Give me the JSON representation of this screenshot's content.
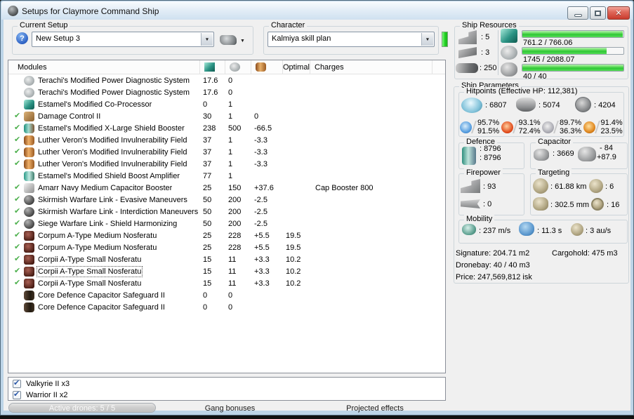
{
  "window": {
    "title": "Setups for Claymore Command Ship"
  },
  "setup": {
    "group_label": "Current Setup",
    "value": "New Setup 3"
  },
  "character": {
    "group_label": "Character",
    "value": "Kalmiya skill plan"
  },
  "resources": {
    "group_label": "Ship Resources",
    "turrets": ": 5",
    "launchers": ": 3",
    "calibration": ": 250",
    "cpu_text": "761.2 / 766.06",
    "cpu_pct": 99.4,
    "powergrid_text": "1745 / 2088.07",
    "powergrid_pct": 83.6,
    "drones_text": "40 / 40",
    "drones_pct": 100
  },
  "modules_table": {
    "header": {
      "modules": "Modules",
      "optimal": "Optimal",
      "charges": "Charges"
    },
    "rows": [
      {
        "icon": "i-pds",
        "active": false,
        "state": "",
        "name": "Terachi's Modified Power Diagnostic System",
        "cpu": "17.6",
        "pg": "0",
        "cap": "",
        "optimal": "",
        "charges": ""
      },
      {
        "icon": "i-pds",
        "active": false,
        "state": "",
        "name": "Terachi's Modified Power Diagnostic System",
        "cpu": "17.6",
        "pg": "0",
        "cap": "",
        "optimal": "",
        "charges": ""
      },
      {
        "icon": "i-coproc",
        "active": false,
        "state": "",
        "name": "Estamel's Modified Co-Processor",
        "cpu": "0",
        "pg": "1",
        "cap": "",
        "optimal": "",
        "charges": ""
      },
      {
        "icon": "i-dc",
        "active": true,
        "state": "",
        "name": "Damage Control II",
        "cpu": "30",
        "pg": "1",
        "cap": "0",
        "optimal": "",
        "charges": ""
      },
      {
        "icon": "i-sbooster",
        "active": true,
        "state": "",
        "name": "Estamel's Modified X-Large Shield Booster",
        "cpu": "238",
        "pg": "500",
        "cap": "-66.5",
        "optimal": "",
        "charges": ""
      },
      {
        "icon": "i-invuln",
        "active": true,
        "state": "",
        "name": "Luther Veron's Modified Invulnerability Field",
        "cpu": "37",
        "pg": "1",
        "cap": "-3.3",
        "optimal": "",
        "charges": ""
      },
      {
        "icon": "i-invuln",
        "active": true,
        "state": "",
        "name": "Luther Veron's Modified Invulnerability Field",
        "cpu": "37",
        "pg": "1",
        "cap": "-3.3",
        "optimal": "",
        "charges": ""
      },
      {
        "icon": "i-invuln",
        "active": true,
        "state": "",
        "name": "Luther Veron's Modified Invulnerability Field",
        "cpu": "37",
        "pg": "1",
        "cap": "-3.3",
        "optimal": "",
        "charges": ""
      },
      {
        "icon": "i-samp",
        "active": false,
        "state": "",
        "name": "Estamel's Modified Shield Boost Amplifier",
        "cpu": "77",
        "pg": "1",
        "cap": "",
        "optimal": "",
        "charges": ""
      },
      {
        "icon": "i-capb",
        "active": true,
        "state": "",
        "name": "Amarr Navy Medium Capacitor Booster",
        "cpu": "25",
        "pg": "150",
        "cap": "+37.6",
        "optimal": "",
        "charges": "Cap Booster 800"
      },
      {
        "icon": "i-link",
        "active": true,
        "state": "",
        "name": "Skirmish Warfare Link - Evasive Maneuvers",
        "cpu": "50",
        "pg": "200",
        "cap": "-2.5",
        "optimal": "",
        "charges": ""
      },
      {
        "icon": "i-link",
        "active": true,
        "state": "",
        "name": "Skirmish Warfare Link - Interdiction Maneuvers",
        "cpu": "50",
        "pg": "200",
        "cap": "-2.5",
        "optimal": "",
        "charges": ""
      },
      {
        "icon": "i-link",
        "active": true,
        "state": "",
        "name": "Siege Warfare Link - Shield Harmonizing",
        "cpu": "50",
        "pg": "200",
        "cap": "-2.5",
        "optimal": "",
        "charges": ""
      },
      {
        "icon": "i-nos",
        "active": true,
        "state": "",
        "name": "Corpum A-Type Medium Nosferatu",
        "cpu": "25",
        "pg": "228",
        "cap": "+5.5",
        "optimal": "19.5",
        "charges": ""
      },
      {
        "icon": "i-nos",
        "active": true,
        "state": "",
        "name": "Corpum A-Type Medium Nosferatu",
        "cpu": "25",
        "pg": "228",
        "cap": "+5.5",
        "optimal": "19.5",
        "charges": ""
      },
      {
        "icon": "i-nos",
        "active": true,
        "state": "",
        "name": "Corpii A-Type Small Nosferatu",
        "cpu": "15",
        "pg": "11",
        "cap": "+3.3",
        "optimal": "10.2",
        "charges": ""
      },
      {
        "icon": "i-nos",
        "active": true,
        "state": "selected",
        "name": "Corpii A-Type Small Nosferatu",
        "cpu": "15",
        "pg": "11",
        "cap": "+3.3",
        "optimal": "10.2",
        "charges": ""
      },
      {
        "icon": "i-nos",
        "active": true,
        "state": "",
        "name": "Corpii A-Type Small Nosferatu",
        "cpu": "15",
        "pg": "11",
        "cap": "+3.3",
        "optimal": "10.2",
        "charges": ""
      },
      {
        "icon": "i-rig",
        "active": false,
        "state": "",
        "name": "Core Defence Capacitor Safeguard II",
        "cpu": "0",
        "pg": "0",
        "cap": "",
        "optimal": "",
        "charges": ""
      },
      {
        "icon": "i-rig",
        "active": false,
        "state": "",
        "name": "Core Defence Capacitor Safeguard II",
        "cpu": "0",
        "pg": "0",
        "cap": "",
        "optimal": "",
        "charges": ""
      }
    ]
  },
  "parameters": {
    "group_label": "Ship Parameters",
    "hitpoints": {
      "group_label": "Hitpoints (Effective HP: 112,381)",
      "shield_hp": ": 6807",
      "armor_hp": ": 5074",
      "structure_hp": ": 4204",
      "resists": [
        {
          "type": "res-em",
          "shield": "95.7%",
          "armor": "91.5%"
        },
        {
          "type": "res-thermal",
          "shield": "93.1%",
          "armor": "72.4%"
        },
        {
          "type": "res-kinetic",
          "shield": "89.7%",
          "armor": "36.3%"
        },
        {
          "type": "res-explosive",
          "shield": "91.4%",
          "armor": "23.5%"
        }
      ]
    },
    "defence": {
      "group_label": "Defence",
      "boost_amount": ": 8796",
      "boost_amount2": ": 8796"
    },
    "capacitor": {
      "group_label": "Capacitor",
      "amount": ": 3669",
      "delta_neg": "- 84",
      "recharge": "+87.9"
    },
    "firepower": {
      "group_label": "Firepower",
      "turret_dps": ": 93",
      "missile_dps": ": 0"
    },
    "targeting": {
      "group_label": "Targeting",
      "range": ": 61.88 km",
      "max_targets": ": 6",
      "scan_resolution": ": 302.5 mm",
      "sensor_strength": ": 16"
    },
    "mobility": {
      "group_label": "Mobility",
      "speed": ": 237 m/s",
      "align_time": ": 11.3 s",
      "warp_speed": ": 3 au/s"
    },
    "signature": "Signature: 204.71 m2",
    "cargohold": "Cargohold: 475 m3",
    "dronebay": "Dronebay: 40 / 40 m3",
    "price": "Price: 247,569,812 isk"
  },
  "drones": {
    "items": [
      {
        "checked": true,
        "label": "Valkyrie II x3"
      },
      {
        "checked": true,
        "label": "Warrior II x2"
      }
    ]
  },
  "bottom": {
    "active_drones": "Active drones: 5 / 5",
    "active_drones_pct": 100,
    "gang_bonuses": "Gang bonuses",
    "projected_effects": "Projected effects"
  },
  "accents": {
    "progress_green": "#3fd13f",
    "check_green": "#4db04d",
    "character_ok_green": "#22cf22",
    "close_button_red": "#c93b2d"
  }
}
